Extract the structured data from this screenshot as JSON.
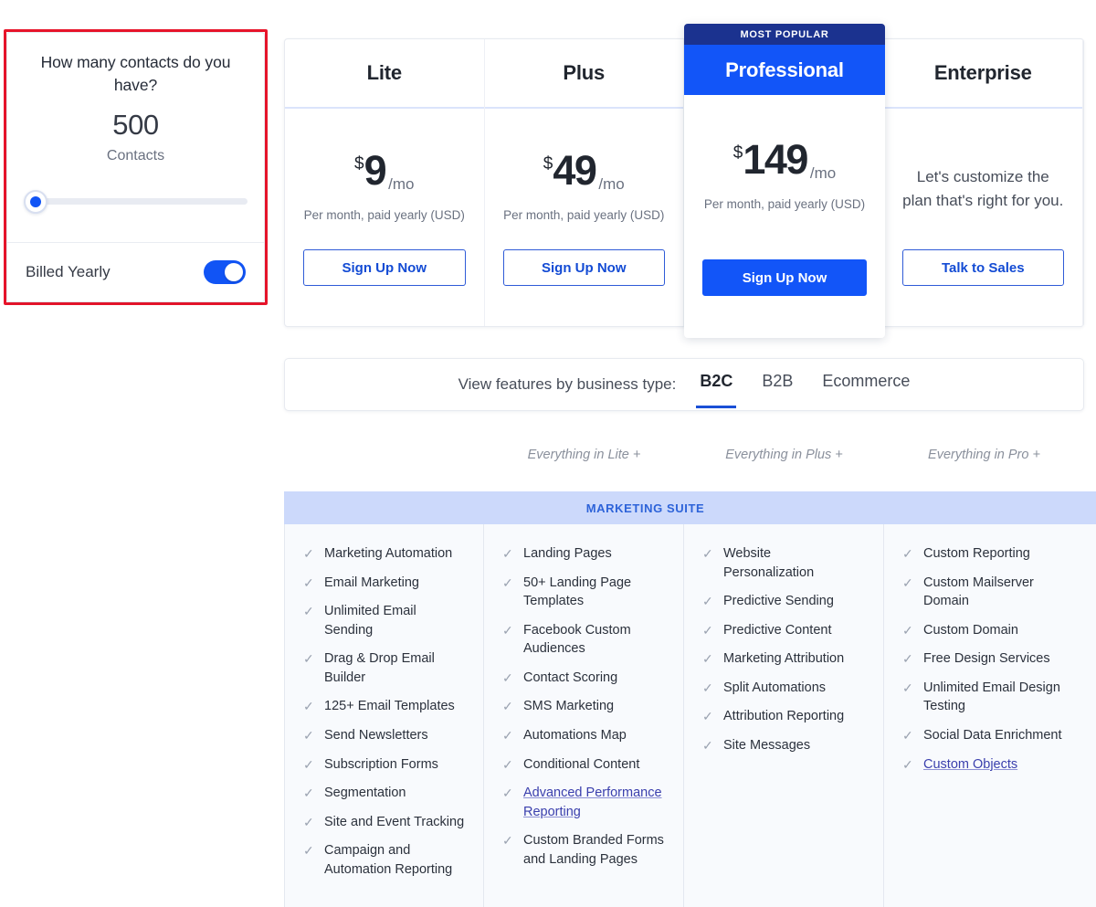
{
  "contact_selector": {
    "question": "How many contacts do you have?",
    "count": "500",
    "unit": "Contacts",
    "billing_label": "Billed Yearly",
    "billing_toggle_on": true,
    "slider_position_pct": 0
  },
  "plans": [
    {
      "name": "Lite",
      "currency": "$",
      "price": "9",
      "period": "/mo",
      "note": "Per month, paid yearly (USD)",
      "cta": "Sign Up Now",
      "featured": false,
      "badge": ""
    },
    {
      "name": "Plus",
      "currency": "$",
      "price": "49",
      "period": "/mo",
      "note": "Per month, paid yearly (USD)",
      "cta": "Sign Up Now",
      "featured": false,
      "badge": ""
    },
    {
      "name": "Professional",
      "currency": "$",
      "price": "149",
      "period": "/mo",
      "note": "Per month, paid yearly (USD)",
      "cta": "Sign Up Now",
      "featured": true,
      "badge": "MOST POPULAR"
    },
    {
      "name": "Enterprise",
      "currency": "",
      "price": "",
      "period": "",
      "note": "",
      "copy": "Let's customize the plan that's right for you.",
      "cta": "Talk to Sales",
      "featured": false,
      "badge": ""
    }
  ],
  "business_type": {
    "label": "View features by business type:",
    "tabs": [
      {
        "label": "B2C",
        "active": true
      },
      {
        "label": "B2B",
        "active": false
      },
      {
        "label": "Ecommerce",
        "active": false
      }
    ]
  },
  "everything_in": [
    "",
    "Everything in Lite +",
    "Everything in Plus +",
    "Everything in Pro +"
  ],
  "suite": {
    "banner": "MARKETING SUITE",
    "columns": [
      {
        "plan": "Lite",
        "features": [
          {
            "text": "Marketing Automation",
            "link": false
          },
          {
            "text": "Email Marketing",
            "link": false
          },
          {
            "text": "Unlimited Email Sending",
            "link": false
          },
          {
            "text": "Drag & Drop Email Builder",
            "link": false
          },
          {
            "text": "125+ Email Templates",
            "link": false
          },
          {
            "text": "Send Newsletters",
            "link": false
          },
          {
            "text": "Subscription Forms",
            "link": false
          },
          {
            "text": "Segmentation",
            "link": false
          },
          {
            "text": "Site and Event Tracking",
            "link": false
          },
          {
            "text": "Campaign and Automation Reporting",
            "link": false
          }
        ]
      },
      {
        "plan": "Plus",
        "features": [
          {
            "text": "Landing Pages",
            "link": false
          },
          {
            "text": "50+ Landing Page Templates",
            "link": false
          },
          {
            "text": "Facebook Custom Audiences",
            "link": false
          },
          {
            "text": "Contact Scoring",
            "link": false
          },
          {
            "text": "SMS Marketing",
            "link": false
          },
          {
            "text": "Automations Map",
            "link": false
          },
          {
            "text": "Conditional Content",
            "link": false
          },
          {
            "text": "Advanced Performance Reporting",
            "link": true
          },
          {
            "text": "Custom Branded Forms and Landing Pages",
            "link": false
          }
        ]
      },
      {
        "plan": "Professional",
        "features": [
          {
            "text": "Website Personalization",
            "link": false
          },
          {
            "text": "Predictive Sending",
            "link": false
          },
          {
            "text": "Predictive Content",
            "link": false
          },
          {
            "text": "Marketing Attribution",
            "link": false
          },
          {
            "text": "Split Automations",
            "link": false
          },
          {
            "text": "Attribution Reporting",
            "link": false
          },
          {
            "text": "Site Messages",
            "link": false
          }
        ]
      },
      {
        "plan": "Enterprise",
        "features": [
          {
            "text": "Custom Reporting",
            "link": false
          },
          {
            "text": "Custom Mailserver Domain",
            "link": false
          },
          {
            "text": "Custom Domain",
            "link": false
          },
          {
            "text": "Free Design Services",
            "link": false
          },
          {
            "text": "Unlimited Email Design Testing",
            "link": false
          },
          {
            "text": "Social Data Enrichment",
            "link": false
          },
          {
            "text": "Custom Objects",
            "link": true
          }
        ]
      }
    ]
  },
  "icons": {
    "check": "✓"
  },
  "colors": {
    "brand_blue": "#1255f8",
    "dark_navy": "#1b328f",
    "banner_bg": "#ccd9fb",
    "banner_text": "#2d63d9",
    "annotation_red": "#e8142a",
    "link": "#3a3fad"
  }
}
